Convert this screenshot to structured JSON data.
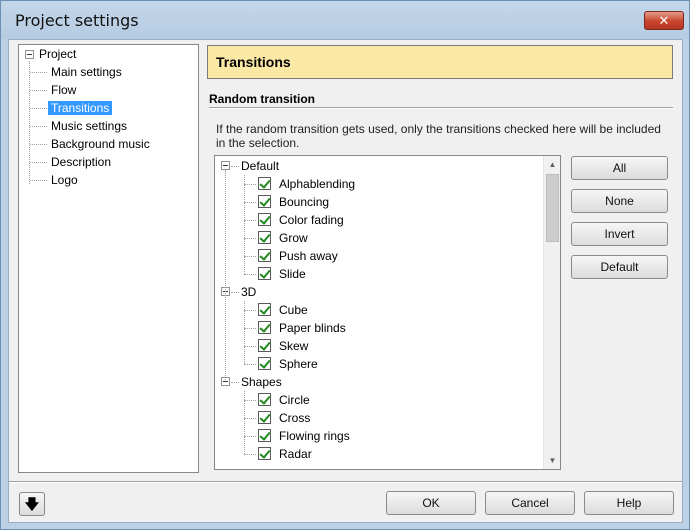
{
  "window": {
    "title": "Project settings",
    "close_glyph": "✕"
  },
  "nav": {
    "root": "Project",
    "items": [
      "Main settings",
      "Flow",
      "Transitions",
      "Music settings",
      "Background music",
      "Description",
      "Logo"
    ],
    "selected": "Transitions"
  },
  "panel": {
    "header": "Transitions",
    "section_title": "Random transition",
    "description": "If the random transition gets used, only the transitions checked here will be included in the selection."
  },
  "transitions": {
    "groups": [
      {
        "name": "Default",
        "items": [
          "Alphablending",
          "Bouncing",
          "Color fading",
          "Grow",
          "Push away",
          "Slide"
        ]
      },
      {
        "name": "3D",
        "items": [
          "Cube",
          "Paper blinds",
          "Skew",
          "Sphere"
        ]
      },
      {
        "name": "Shapes",
        "items": [
          "Circle",
          "Cross",
          "Flowing rings",
          "Radar"
        ]
      }
    ]
  },
  "side_buttons": {
    "all": "All",
    "none": "None",
    "invert": "Invert",
    "default": "Default"
  },
  "footer": {
    "ok": "OK",
    "cancel": "Cancel",
    "help": "Help",
    "arrow_glyph": "🡇"
  }
}
